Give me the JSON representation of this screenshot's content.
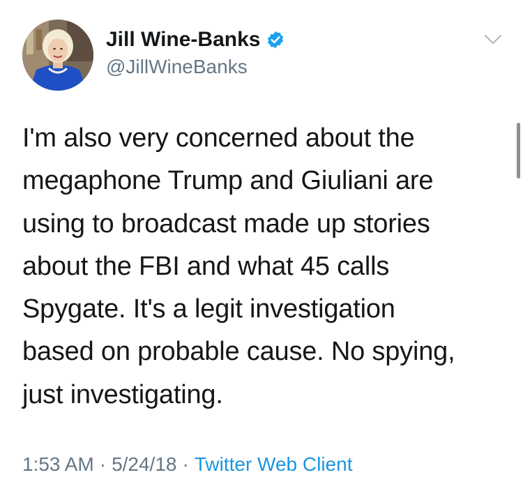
{
  "author": {
    "display_name": "Jill Wine-Banks",
    "handle": "@JillWineBanks",
    "verified": true,
    "avatar_icon": "profile-photo"
  },
  "tweet": {
    "text_lines": [
      "I'm also very concerned about the",
      "megaphone Trump and Giuliani are",
      "using to broadcast made up stories",
      "about the FBI and what 45 calls",
      "Spygate. It's a legit investigation",
      "based on probable cause. No spying,",
      "just investigating."
    ]
  },
  "meta": {
    "time": "1:53 AM",
    "separator": "·",
    "date": "5/24/18",
    "client": "Twitter Web Client"
  },
  "icons": {
    "verified": "verified-badge-icon",
    "menu": "chevron-down-icon"
  },
  "colors": {
    "verified": "#1da1f2",
    "link": "#1b95e0",
    "secondary_text": "#657786",
    "primary_text": "#14171a"
  }
}
